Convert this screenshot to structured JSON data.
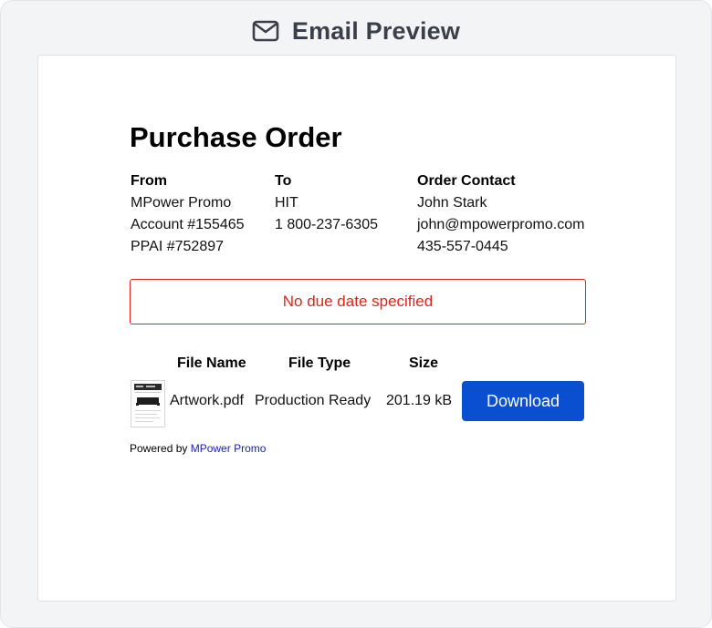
{
  "header": {
    "title": "Email Preview",
    "icon": "mail-icon"
  },
  "order": {
    "title": "Purchase Order",
    "from": {
      "heading": "From",
      "lines": [
        "MPower Promo",
        "Account #155465",
        "PPAI #752897"
      ]
    },
    "to": {
      "heading": "To",
      "lines": [
        "HIT",
        "1 800-237-6305"
      ]
    },
    "contact": {
      "heading": "Order Contact",
      "lines": [
        "John Stark",
        "john@mpowerpromo.com",
        "435-557-0445"
      ]
    },
    "due_notice": "No due date specified"
  },
  "files": {
    "headers": {
      "name": "File Name",
      "type": "File Type",
      "size": "Size"
    },
    "rows": [
      {
        "name": "Artwork.pdf",
        "type": "Production Ready",
        "size": "201.19 kB",
        "action": "Download"
      }
    ]
  },
  "footer": {
    "prefix": "Powered by",
    "link": "MPower Promo"
  },
  "colors": {
    "accent": "#0b4fd1",
    "warning": "#e0221a",
    "link": "#1a23b8"
  }
}
